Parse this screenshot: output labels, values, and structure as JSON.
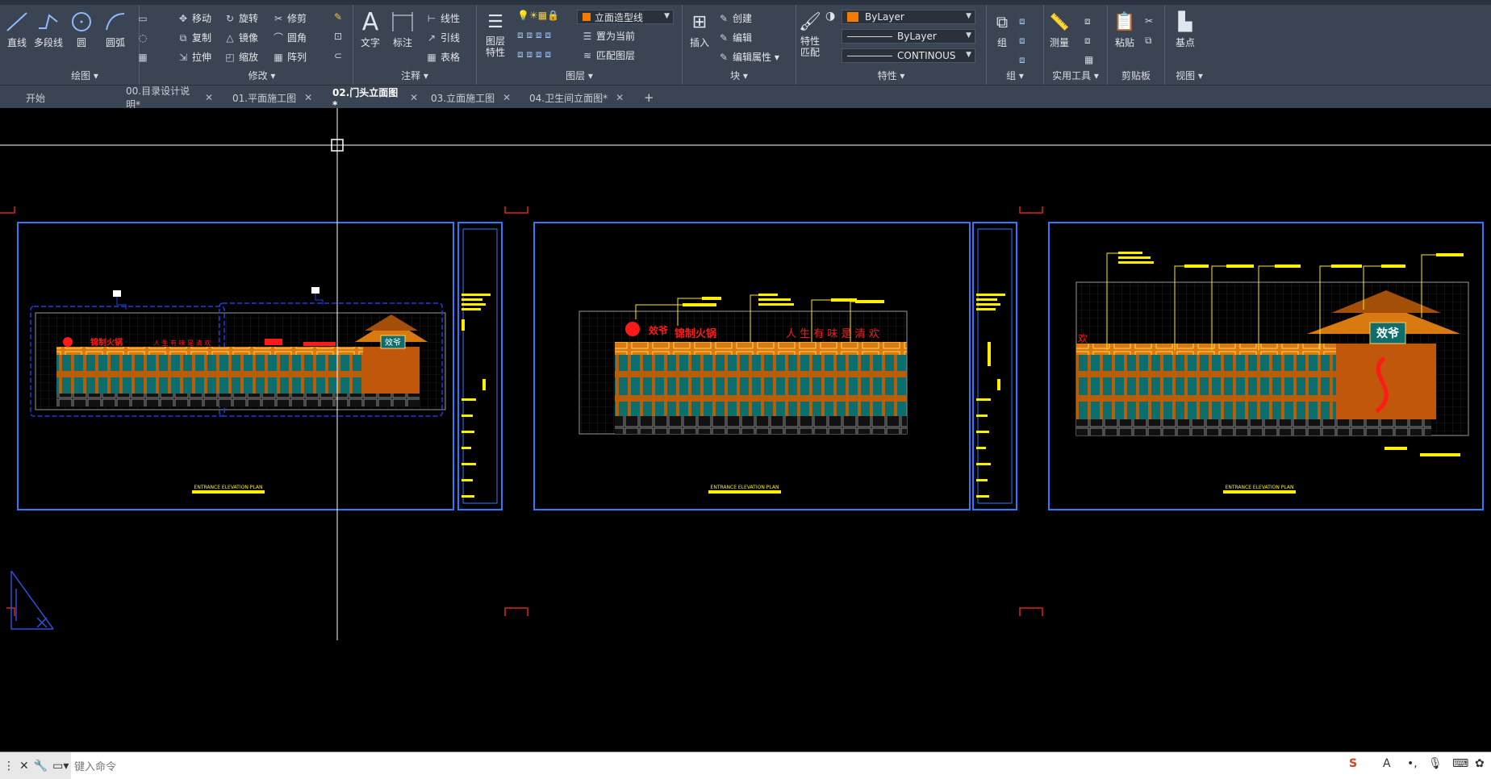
{
  "ribbon": {
    "draw": {
      "title": "绘图 ▾",
      "line": "直线",
      "polyline": "多段线",
      "circle": "圆",
      "arc": "圆弧"
    },
    "modify": {
      "title": "修改 ▾",
      "move": "移动",
      "rotate": "旋转",
      "trim": "修剪",
      "copy": "复制",
      "mirror": "镜像",
      "fillet": "圆角",
      "stretch": "拉伸",
      "scale": "缩放",
      "array": "阵列"
    },
    "annotation": {
      "title": "注释 ▾",
      "text": "文字",
      "dimension": "标注",
      "linetype": "线性",
      "leader": "引线",
      "table": "表格"
    },
    "layers": {
      "title": "图层 ▾",
      "layer_props": "图层\n特性",
      "current_layer": "立面造型线",
      "set_current": "置为当前",
      "match_layer": "匹配图层"
    },
    "block": {
      "title": "块 ▾",
      "insert": "插入",
      "create": "创建",
      "edit": "编辑",
      "edit_attr": "编辑属性 ▾"
    },
    "properties": {
      "title": "特性 ▾",
      "match": "特性\n匹配",
      "color": "ByLayer",
      "linetype_val": "ByLayer",
      "lineweight": "CONTINOUS"
    },
    "groups": {
      "title": "组 ▾",
      "group": "组"
    },
    "utilities": {
      "title": "实用工具 ▾",
      "measure": "测量"
    },
    "clipboard": {
      "title": "剪贴板",
      "paste": "粘贴"
    },
    "view": {
      "title": "视图 ▾",
      "base": "基点"
    }
  },
  "tabs": [
    {
      "label": "开始",
      "close": ""
    },
    {
      "label": "00.目录设计说明*",
      "close": "✕"
    },
    {
      "label": "01.平面施工图",
      "close": "✕"
    },
    {
      "label": "02.门头立面图*",
      "close": "✕"
    },
    {
      "label": "03.立面施工图",
      "close": "✕"
    },
    {
      "label": "04.卫生间立面图*",
      "close": "✕"
    }
  ],
  "tab_add": "+",
  "drawing": {
    "sheet1": {
      "sign_brand": "锦制火锅",
      "sign_slogan": "人 生 有 味 是 清 欢",
      "plaque": "效爷",
      "caption": "ENTRANCE ELEVATION PLAN"
    },
    "sheet2": {
      "sign_logo": "效爷",
      "sign_brand": "锦制火锅",
      "sign_slogan": "人 生 有 味 是 清 欢",
      "caption": "ENTRANCE ELEVATION PLAN"
    },
    "sheet3": {
      "plaque": "效爷",
      "side_char": "欢",
      "caption": "ENTRANCE ELEVATION PLAN"
    }
  },
  "command": {
    "placeholder": "键入命令"
  },
  "colors": {
    "frame": "#1f6fe8",
    "sheet_border": "#2a7bff",
    "facade": "#d97a10",
    "window": "#0e6e6e",
    "sign_red": "#ff1a1a",
    "label_yellow": "#ffee00"
  }
}
